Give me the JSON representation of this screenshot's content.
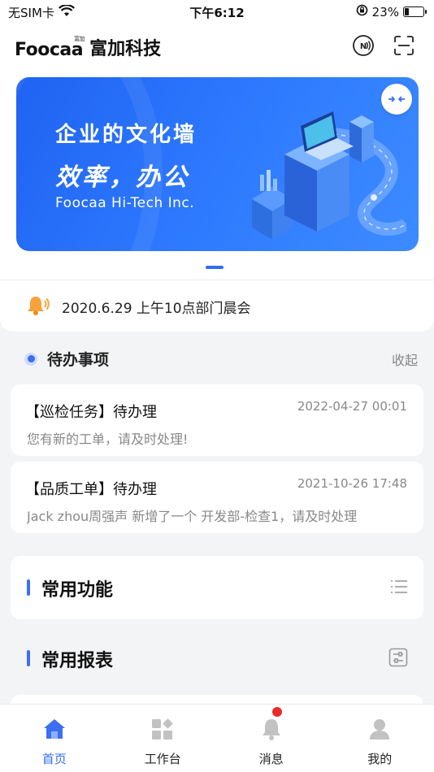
{
  "status_bar": {
    "carrier": "无SIM卡",
    "time": "下午6:12",
    "battery_percent_label": "23%",
    "battery_level": 0.23
  },
  "header": {
    "logo_text": "Foocaa",
    "logo_superscript": "富加",
    "title": "富加科技",
    "icons": [
      "nfc-icon",
      "scan-icon"
    ]
  },
  "banner": {
    "line1": "企业的文化墙",
    "line2": "效率，办公",
    "line3": "Foocaa Hi-Tech Inc."
  },
  "notice": {
    "text": "2020.6.29 上午10点部门晨会"
  },
  "todo": {
    "title": "待办事项",
    "collapse_label": "收起",
    "items": [
      {
        "title": "【巡检任务】待办理",
        "date": "2022-04-27 00:01",
        "desc": "您有新的工单，请及时处理!"
      },
      {
        "title": "【品质工单】待办理",
        "date": "2021-10-26 17:48",
        "desc": "Jack zhou周强声 新增了一个 开发部-检查1，请及时处理"
      }
    ]
  },
  "common_functions": {
    "title": "常用功能"
  },
  "common_reports": {
    "title": "常用报表"
  },
  "tabbar": {
    "tabs": [
      {
        "label": "首页",
        "icon": "home-icon",
        "active": true
      },
      {
        "label": "工作台",
        "icon": "workbench-icon",
        "active": false
      },
      {
        "label": "消息",
        "icon": "bell-icon",
        "active": false,
        "badge": true
      },
      {
        "label": "我的",
        "icon": "profile-icon",
        "active": false
      }
    ]
  },
  "colors": {
    "accent": "#2f6cf6",
    "badge": "#ea2a2a",
    "banner_start": "#1f63f2",
    "banner_end": "#3d8bff"
  }
}
